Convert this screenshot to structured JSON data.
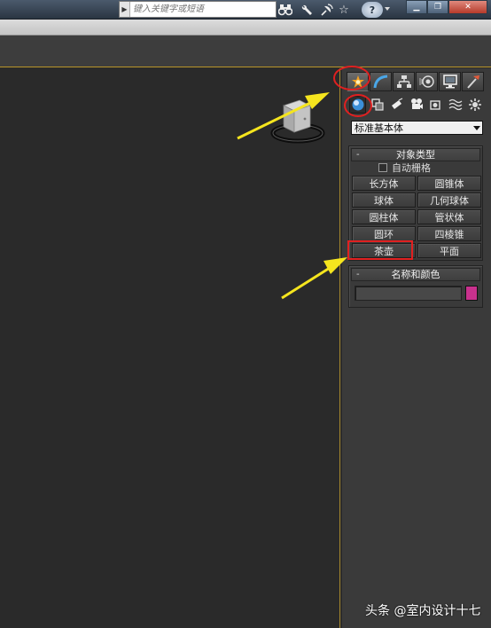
{
  "titlebar": {
    "search_placeholder": "键入关键字或短语",
    "help_label": "?",
    "minimize_label": "▁",
    "restore_label": "❐",
    "close_label": "✕"
  },
  "command_panel": {
    "tabs": [
      "create-icon",
      "modify-icon",
      "hierarchy-icon",
      "motion-icon",
      "display-icon",
      "utilities-icon"
    ],
    "active_tab": "create-icon",
    "categories": [
      "geometry-icon",
      "shapes-icon",
      "lights-icon",
      "cameras-icon",
      "helpers-icon",
      "spacewarps-icon",
      "systems-icon"
    ],
    "active_category": "geometry-icon",
    "primitive_type": "标准基本体",
    "object_type": {
      "title": "对象类型",
      "collapse": "-",
      "autogrid_label": "自动栅格",
      "autogrid_checked": false,
      "buttons": [
        "长方体",
        "圆锥体",
        "球体",
        "几何球体",
        "圆柱体",
        "管状体",
        "圆环",
        "四棱锥",
        "茶壶",
        "平面"
      ],
      "highlighted_button": "茶壶"
    },
    "name_color": {
      "title": "名称和颜色",
      "collapse": "-",
      "name_value": "",
      "color": "#c8318d"
    }
  },
  "annotations": {
    "highlight_color": "#e02020",
    "arrow_color": "#f5e51e"
  },
  "watermark": "头条 @室内设计十七"
}
